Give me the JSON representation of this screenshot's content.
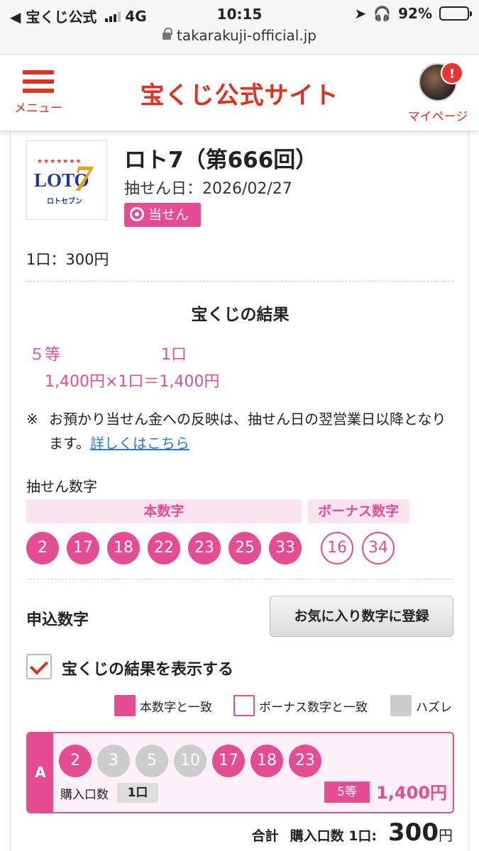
{
  "status_bar": {
    "carrier": "◀ 宝くじ公式",
    "network": "4G",
    "time": "10:15",
    "battery": "92%",
    "battery_level": 0.92
  },
  "url": "takarakuji-official.jp",
  "header": {
    "menu_label": "メニュー",
    "site_title": "宝くじ公式サイト",
    "mypage_label": "マイページ",
    "alert_badge": "!"
  },
  "lottery": {
    "logo_text": "LOTO",
    "logo_number": "7",
    "logo_kana": "ロトセブン",
    "title": "ロト7（第666回）",
    "draw_date": "抽せん日：2026/02/27",
    "status_badge": "当せん",
    "price": "1口：300円"
  },
  "result": {
    "heading": "宝くじの結果",
    "grade": "５等",
    "count": "1口",
    "calculation": "1,400円×1口＝1,400円",
    "note_mark": "※",
    "note_text": "お預かり当せん金への反映は、抽せん日の翌営業日以降となります。",
    "note_link": "詳しくはこちら"
  },
  "drawn_numbers": {
    "label": "抽せん数字",
    "main_heading": "本数字",
    "bonus_heading": "ボーナス数字",
    "main": [
      "2",
      "17",
      "18",
      "22",
      "23",
      "25",
      "33"
    ],
    "bonus": [
      "16",
      "34"
    ]
  },
  "application": {
    "label": "申込数字",
    "favorite_button": "お気に入り数字に登録",
    "show_result_label": "宝くじの結果を表示する",
    "show_result_checked": true,
    "legend": {
      "main_match": "本数字と一致",
      "bonus_match": "ボーナス数字と一致",
      "miss": "ハズレ"
    },
    "ticket": {
      "letter": "A",
      "numbers": [
        {
          "value": "2",
          "state": "main"
        },
        {
          "value": "3",
          "state": "miss"
        },
        {
          "value": "5",
          "state": "miss"
        },
        {
          "value": "10",
          "state": "miss"
        },
        {
          "value": "17",
          "state": "main"
        },
        {
          "value": "18",
          "state": "main"
        },
        {
          "value": "23",
          "state": "main"
        }
      ],
      "buy_label": "購入口数",
      "buy_count": "1口",
      "grade": "5等",
      "amount": "1,400円"
    },
    "total": {
      "label": "合計",
      "count_label": "購入口数 1口:",
      "amount": "300",
      "unit": "円"
    }
  },
  "colors": {
    "brand_red": "#e0301e",
    "pink": "#e54c94",
    "pink_light": "#fbe3f0",
    "miss_gray": "#cccccc"
  }
}
